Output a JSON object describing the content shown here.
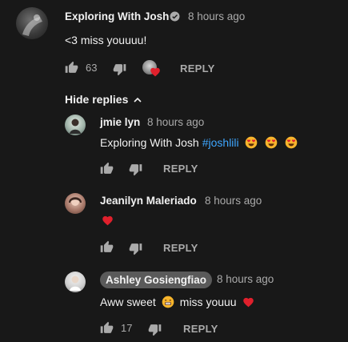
{
  "comment": {
    "author": "Exploring With Josh",
    "timestamp": "8 hours ago",
    "text": "<3 miss youuuu!",
    "like_count": "63",
    "reply_label": "REPLY"
  },
  "toggle_label": "Hide replies",
  "replies": [
    {
      "author": "jmie lyn",
      "timestamp": "8 hours ago",
      "text_prefix": "Exploring With Josh",
      "hashtag": "#joshlili",
      "reply_label": "REPLY"
    },
    {
      "author": "Jeanilyn Maleriado",
      "timestamp": "8 hours ago",
      "reply_label": "REPLY"
    },
    {
      "author": "Ashley Gosiengfiao",
      "timestamp": "8 hours ago",
      "text_a": "Aww sweet",
      "text_b": "miss youuu",
      "like_count": "17",
      "reply_label": "REPLY"
    }
  ],
  "icons": {
    "like": "thumbs-up-icon",
    "dislike": "thumbs-down-icon",
    "verified": "verified-check-icon",
    "heart": "heart-icon",
    "heart_eyes": "heart-eyes-emoji",
    "grin": "grinning-emoji",
    "chevron": "chevron-up-icon"
  },
  "colors": {
    "background": "#181818",
    "text_primary": "#f1f1f1",
    "text_secondary": "#aaaaaa",
    "link": "#3ea6ff",
    "heart": "#e0202c",
    "chip": "#5a5a5a"
  }
}
